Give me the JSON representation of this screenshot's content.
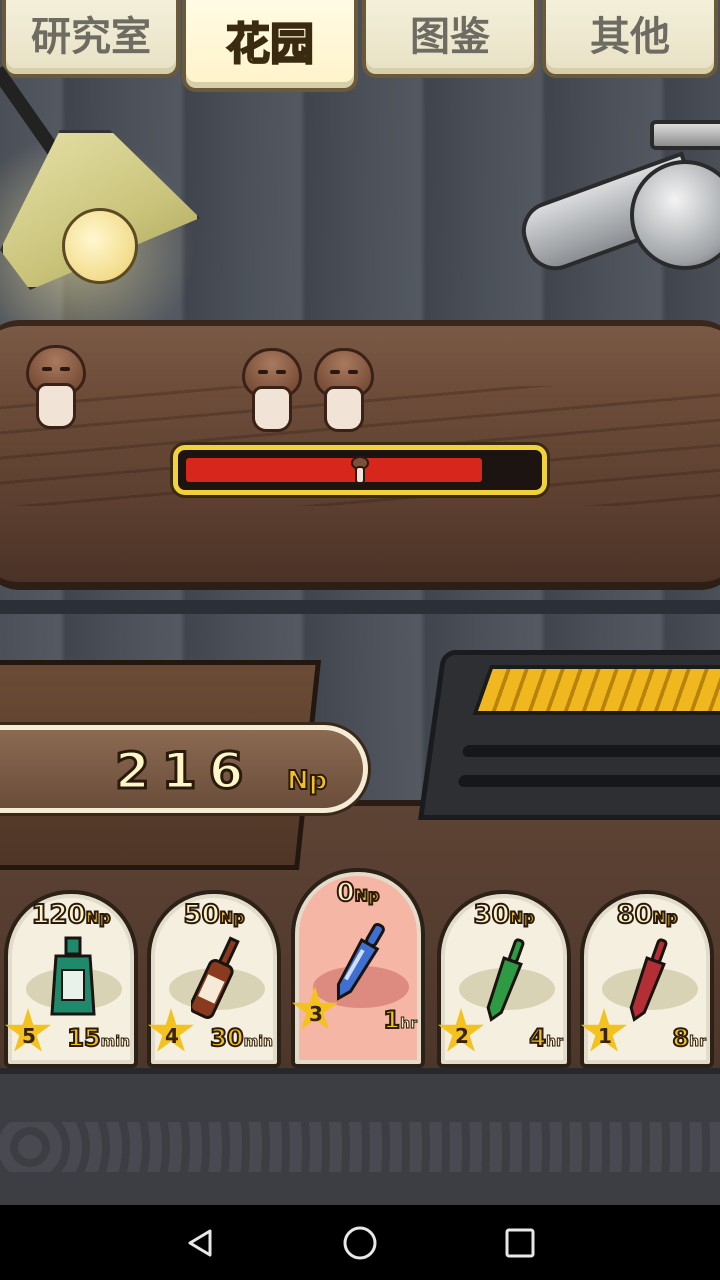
{
  "tabs": [
    {
      "label": "研究室",
      "active": false
    },
    {
      "label": "花园",
      "active": true
    },
    {
      "label": "图鉴",
      "active": false
    },
    {
      "label": "其他",
      "active": false
    }
  ],
  "growth": {
    "progress": 0.85
  },
  "counter": {
    "value": "216",
    "unit": "Np"
  },
  "shop": [
    {
      "price": "120",
      "unit": "Np",
      "stars": "5",
      "time": "15",
      "time_unit": "min",
      "item": "green-bottle-icon",
      "color": "#1f8a6b"
    },
    {
      "price": "50",
      "unit": "Np",
      "stars": "4",
      "time": "30",
      "time_unit": "min",
      "item": "brown-bottle-icon",
      "color": "#8a3b1f"
    },
    {
      "price": "0",
      "unit": "Np",
      "stars": "3",
      "time": "1",
      "time_unit": "hr",
      "item": "blue-ampoule-icon",
      "color": "#3f6fd0",
      "selected": true
    },
    {
      "price": "30",
      "unit": "Np",
      "stars": "2",
      "time": "4",
      "time_unit": "hr",
      "item": "green-ampoule-icon",
      "color": "#2e9a44"
    },
    {
      "price": "80",
      "unit": "Np",
      "stars": "1",
      "time": "8",
      "time_unit": "hr",
      "item": "red-ampoule-icon",
      "color": "#b32e35"
    }
  ],
  "navbar": {
    "back": "back-icon",
    "home": "home-icon",
    "recents": "recents-icon"
  }
}
